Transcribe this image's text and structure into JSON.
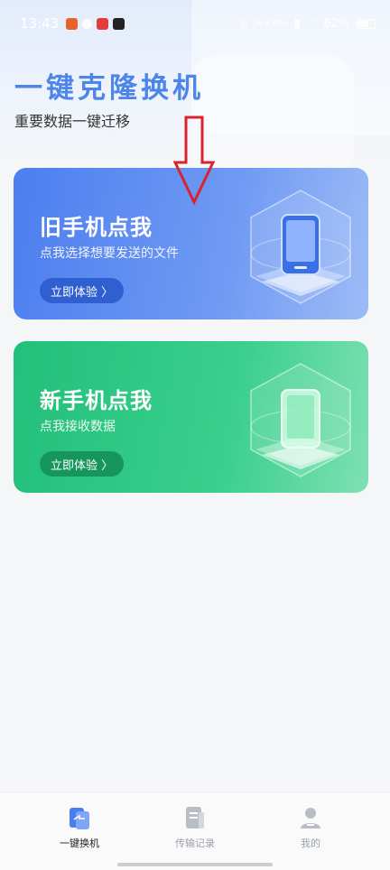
{
  "status_bar": {
    "time": "13:43",
    "network_speed": "26.3 KB/s",
    "battery_percent": "62%"
  },
  "header": {
    "title": "一键克隆换机",
    "subtitle": "重要数据一键迁移"
  },
  "cards": {
    "old_phone": {
      "title": "旧手机点我",
      "description": "点我选择想要发送的文件",
      "button_label": "立即体验 〉",
      "color": "#4d7ef0"
    },
    "new_phone": {
      "title": "新手机点我",
      "description": "点我接收数据",
      "button_label": "立即体验 〉",
      "color": "#22c07a"
    }
  },
  "annotation": {
    "arrow_color": "#d9232e",
    "icon": "down-arrow-icon"
  },
  "tabbar": {
    "tabs": [
      {
        "label": "一键换机",
        "icon": "phone-swap-icon",
        "active": true
      },
      {
        "label": "传输记录",
        "icon": "document-icon",
        "active": false
      },
      {
        "label": "我的",
        "icon": "user-icon",
        "active": false
      }
    ]
  }
}
